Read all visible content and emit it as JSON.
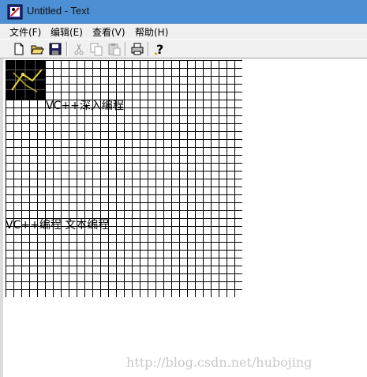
{
  "window": {
    "title": "Untitled - Text"
  },
  "menu": [
    {
      "label": "文件(F)"
    },
    {
      "label": "编辑(E)"
    },
    {
      "label": "查看(V)"
    },
    {
      "label": "帮助(H)"
    }
  ],
  "toolbar": {
    "buttons": [
      "new-icon",
      "open-icon",
      "save-icon",
      "cut-icon",
      "copy-icon",
      "paste-icon",
      "print-icon",
      "help-icon"
    ]
  },
  "canvas": {
    "text1": "VC++深入编程",
    "text2": "VC++编程 文本编程"
  },
  "watermark": "http://blog.csdn.net/hubojing",
  "colors": {
    "titlebar": "#4d8fd4",
    "chrome": "#f0f0f0",
    "grid": "#000000"
  }
}
